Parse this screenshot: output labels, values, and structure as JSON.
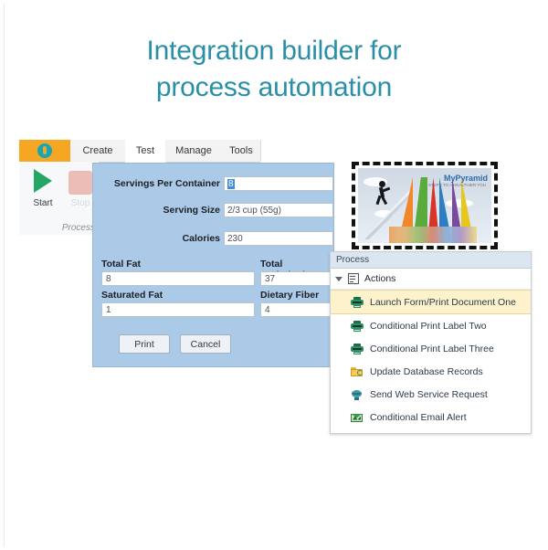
{
  "headline": {
    "line1": "Integration builder for",
    "line2": "process automation",
    "color": "#2a8fa6"
  },
  "ribbon": {
    "app_button_icon": "app-logo-icon",
    "app_button_color": "#f5a623",
    "tabs": [
      {
        "label": "Create",
        "active": false
      },
      {
        "label": "Test",
        "active": true
      },
      {
        "label": "Manage",
        "active": false
      },
      {
        "label": "Tools",
        "active": false
      }
    ],
    "group": {
      "label": "Process",
      "start_label": "Start",
      "stop_label": "Stop"
    }
  },
  "form": {
    "fields": [
      {
        "label": "Servings Per Container",
        "value": "8",
        "selected": true
      },
      {
        "label": "Serving Size",
        "value": "2/3 cup (55g)"
      },
      {
        "label": "Calories",
        "value": "230"
      }
    ],
    "columns": [
      {
        "label": "Total Fat",
        "value": "8"
      },
      {
        "label": "Saturated Fat",
        "value": "1"
      },
      {
        "label": "Total Carbohydr",
        "value": "37"
      },
      {
        "label": "Dietary Fiber",
        "value": "4"
      }
    ],
    "buttons": {
      "print": "Print",
      "cancel": "Cancel"
    },
    "background": "#abcae8"
  },
  "image": {
    "name": "mypyramid-image",
    "title": "MyPyramid",
    "subtitle": "STEPS TO A HEALTHIER YOU"
  },
  "process_panel": {
    "title": "Process",
    "tree_root": "Actions",
    "selected_color": "#fdf2cc",
    "items": [
      {
        "label": "Launch Form/Print Document One",
        "icon": "printer-icon",
        "selected": true
      },
      {
        "label": "Conditional Print Label Two",
        "icon": "printer-icon",
        "selected": false
      },
      {
        "label": "Conditional Print Label Three",
        "icon": "printer-icon",
        "selected": false
      },
      {
        "label": "Update Database Records",
        "icon": "folder-refresh-icon",
        "selected": false
      },
      {
        "label": "Send Web Service Request",
        "icon": "globe-icon",
        "selected": false
      },
      {
        "label": "Conditional Email Alert",
        "icon": "email-icon",
        "selected": false
      }
    ]
  }
}
